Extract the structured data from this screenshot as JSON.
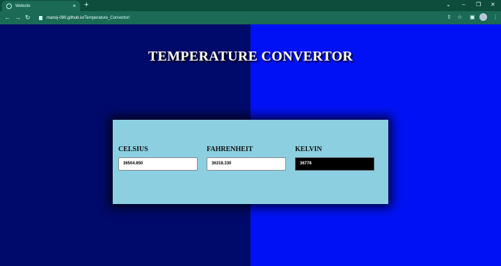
{
  "browser": {
    "tab_title": "Website",
    "tab_close": "×",
    "new_tab": "+",
    "url_host": "manoj-090.github.io",
    "url_path": "/Temperature_Convertor/",
    "window_controls": [
      "⌄",
      "–",
      "❐",
      "✕"
    ],
    "nav": {
      "back": "←",
      "forward": "→",
      "reload": "↻"
    }
  },
  "page": {
    "heading": "TEMPERATURE CONVERTOR",
    "fields": [
      {
        "label": "CELSIUS",
        "value": "36504.850"
      },
      {
        "label": "FAHRENHEIT",
        "value": "36318.330"
      },
      {
        "label": "KELVIN",
        "value": "36778"
      }
    ],
    "colors": {
      "left_bg": "#000a6a",
      "right_bg": "#0012f5",
      "card_bg": "#8ccfe0",
      "browser_tab": "#0e4d3b",
      "browser_toolbar": "#1a6a55"
    }
  }
}
